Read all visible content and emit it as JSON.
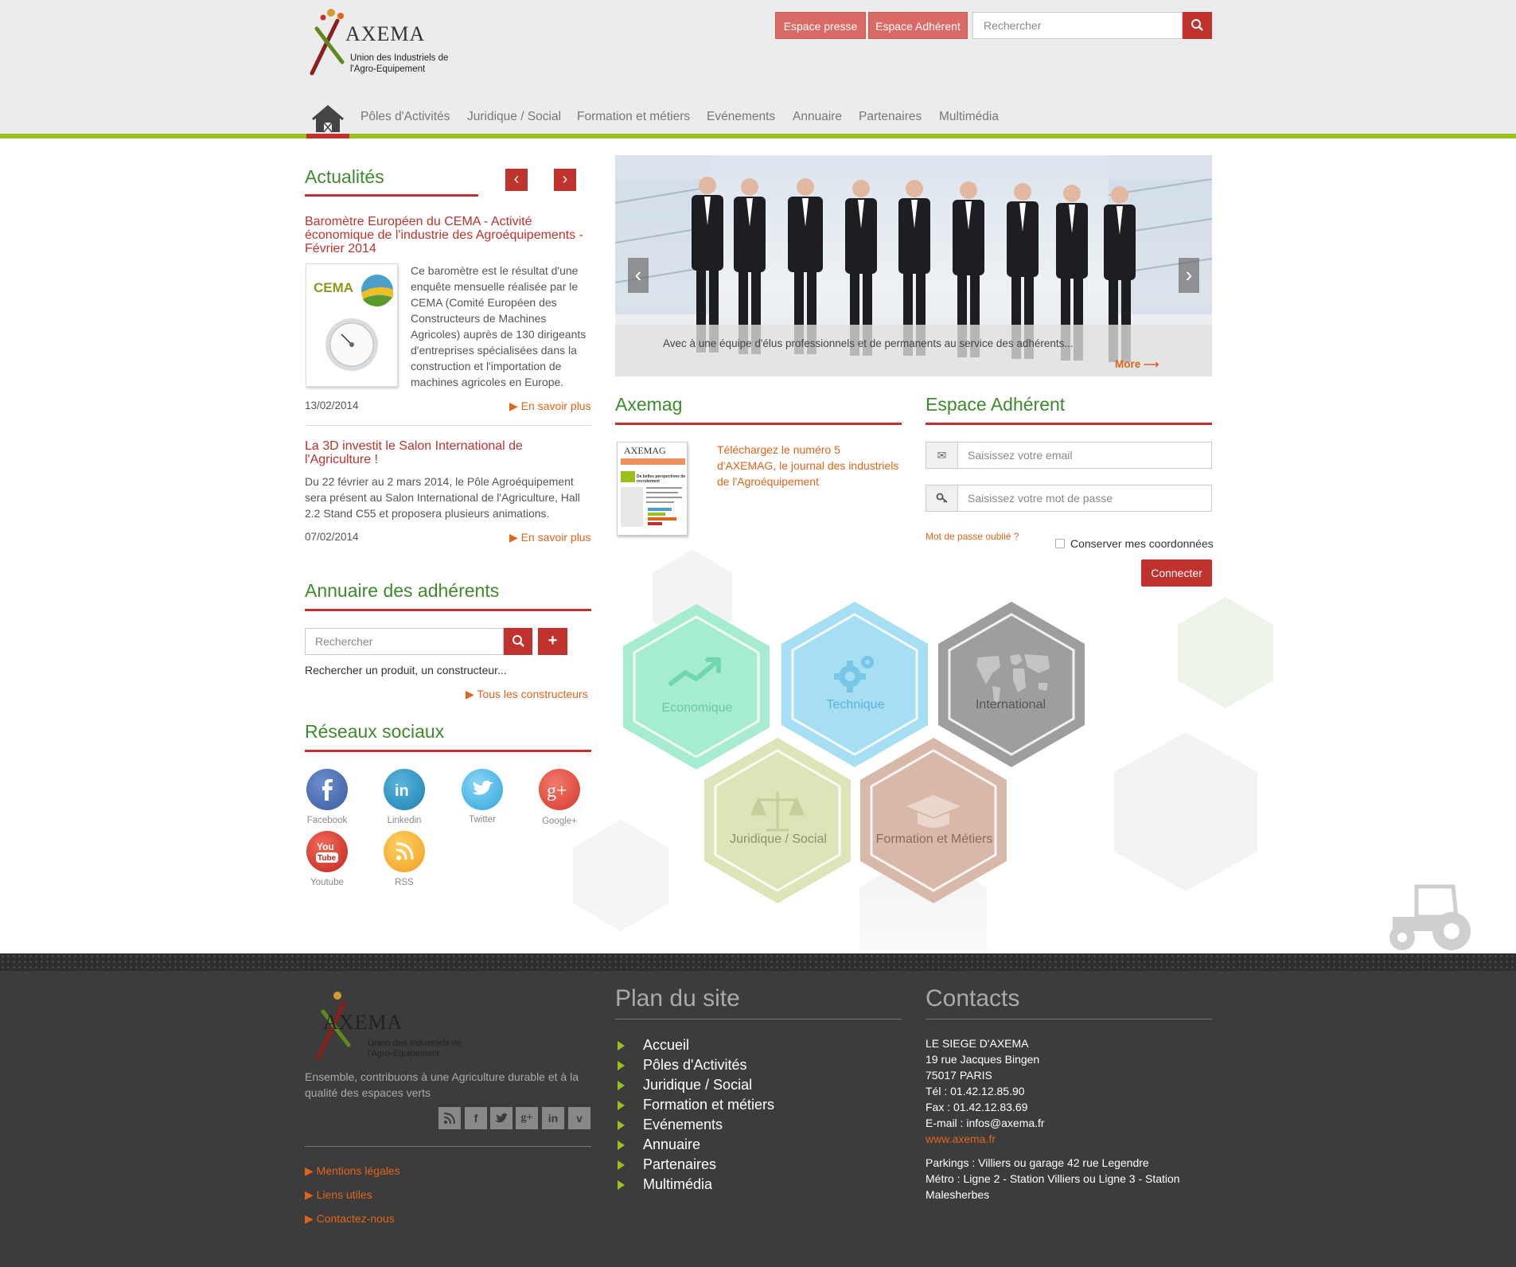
{
  "header": {
    "logo_text": "AXEMA",
    "logo_subtitle_1": "Union des Industriels de",
    "logo_subtitle_2": "l'Agro-Equipement",
    "btn_presse": "Espace presse",
    "btn_adherent": "Espace Adhérent",
    "search_placeholder": "Rechercher"
  },
  "nav": {
    "items": [
      "Pôles d'Activités",
      "Juridique / Social",
      "Formation et métiers",
      "Evénements",
      "Annuaire",
      "Partenaires",
      "Multimédia"
    ]
  },
  "actualites": {
    "title": "Actualités",
    "news": [
      {
        "title": "Baromètre Européen du CEMA - Activité économique de l'industrie des Agroéquipements - Février 2014",
        "thumb_label": "CEMA",
        "text": "Ce baromètre est le résultat d'une enquête mensuelle réalisée par le CEMA (Comité Européen des Constructeurs de Machines Agricoles) auprès de 130 dirigeants d'entreprises spécialisées dans la construction et l'importation de machines agricoles en Europe.",
        "date": "13/02/2014",
        "more": "En savoir plus"
      },
      {
        "title": "La 3D investit le Salon International de l'Agriculture !",
        "text": "Du 22 février au 2 mars 2014, le Pôle Agroéquipement sera présent au Salon International de l'Agriculture, Hall 2.2 Stand C55 et proposera plusieurs animations.",
        "date": "07/02/2014",
        "more": "En savoir plus"
      }
    ]
  },
  "slider": {
    "caption": "Avec à une équipe d'élus professionnels et de permanents au service des adhérents...",
    "more": "More ⟶"
  },
  "axemag": {
    "title": "Axemag",
    "text": "Téléchargez le numéro 5 d'AXEMAG, le journal des industriels de l'Agroéquipement",
    "cover_title": "AXEMAG",
    "cover_headline": "De belles perspectives de recrutement"
  },
  "espace": {
    "title": "Espace Adhérent",
    "email_placeholder": "Saisissez votre email",
    "password_placeholder": "Saisissez votre mot de passe",
    "forgot": "Mot de passe oublié ?",
    "remember": "Conserver mes coordonnées",
    "connect": "Connecter"
  },
  "annuaire": {
    "title": "Annuaire des adhérents",
    "search_placeholder": "Rechercher",
    "hint": "Rechercher un produit, un constructeur...",
    "all_link": "Tous les constructeurs"
  },
  "reseaux": {
    "title": "Réseaux sociaux",
    "items": [
      "Facebook",
      "Linkedin",
      "Twitter",
      "Google+",
      "Youtube",
      "RSS"
    ]
  },
  "hexes": [
    "Economique",
    "Technique",
    "International",
    "Juridique / Social",
    "Formation et Métiers"
  ],
  "footer": {
    "tagline": "Ensemble, contribuons à une Agriculture durable et à la qualité des espaces verts",
    "links": [
      "Mentions légales",
      "Liens utiles",
      "Contactez-nous"
    ],
    "plan_title": "Plan du site",
    "plan_items": [
      "Accueil",
      "Pôles d'Activités",
      "Juridique / Social",
      "Formation et métiers",
      "Evénements",
      "Annuaire",
      "Partenaires",
      "Multimédia"
    ],
    "contacts_title": "Contacts",
    "contact_lines": [
      "LE SIEGE D'AXEMA",
      "19 rue Jacques Bingen",
      "75017 PARIS",
      "Tél : 01.42.12.85.90",
      "Fax : 01.42.12.83.69",
      "E-mail : infos@axema.fr"
    ],
    "website": "www.axema.fr",
    "parkings": "Parkings : Villiers ou garage 42 rue Legendre",
    "metro_1": "Métro : Ligne 2 - Station Villiers ou Ligne 3 - Station",
    "metro_2": "Malesherbes"
  },
  "colors": {
    "green": "#3e8a2c",
    "red": "#c0322d",
    "orange": "#e2641a",
    "lime": "#9bbf1c",
    "footer_bg": "#3c3c3c"
  }
}
